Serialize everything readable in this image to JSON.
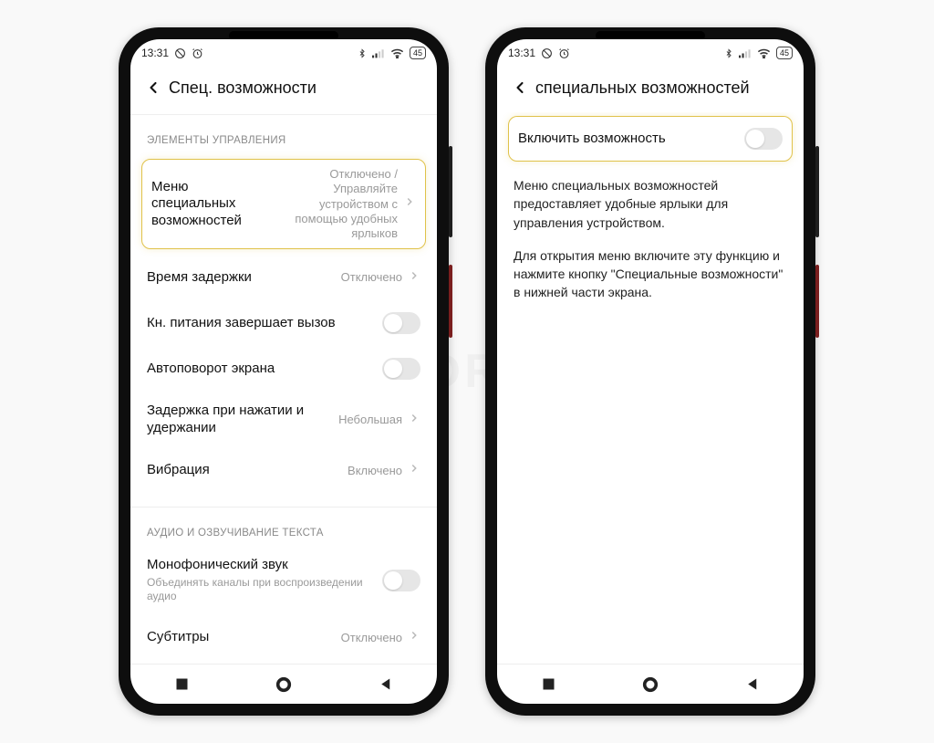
{
  "watermark": "SIBDROID",
  "status": {
    "time": "13:31",
    "battery": "45"
  },
  "left_screen": {
    "title": "Спец. возможности",
    "section1_label": "ЭЛЕМЕНТЫ УПРАВЛЕНИЯ",
    "item_menu_title": "Меню специальных возможностей",
    "item_menu_value": "Отключено / Управляйте устройством с помощью удобных ярлыков",
    "item_delay_title": "Время задержки",
    "item_delay_value": "Отключено",
    "item_power_title": "Кн. питания завершает вызов",
    "item_rotate_title": "Автоповорот экрана",
    "item_touchhold_title": "Задержка при нажатии и удержании",
    "item_touchhold_value": "Небольшая",
    "item_vibration_title": "Вибрация",
    "item_vibration_value": "Включено",
    "section2_label": "АУДИО И ОЗВУЧИВАНИЕ ТЕКСТА",
    "item_mono_title": "Монофонический звук",
    "item_mono_sub": "Объединять каналы при воспроизведении аудио",
    "item_sub_title": "Субтитры",
    "item_sub_value": "Отключено"
  },
  "right_screen": {
    "title": "специальных возможностей",
    "toggle_label": "Включить возможность",
    "para1": "Меню специальных возможностей предоставляет удобные ярлыки для управления устройством.",
    "para2": "Для открытия меню включите эту функцию и нажмите кнопку \"Специальные возможности\" в нижней части экрана."
  }
}
